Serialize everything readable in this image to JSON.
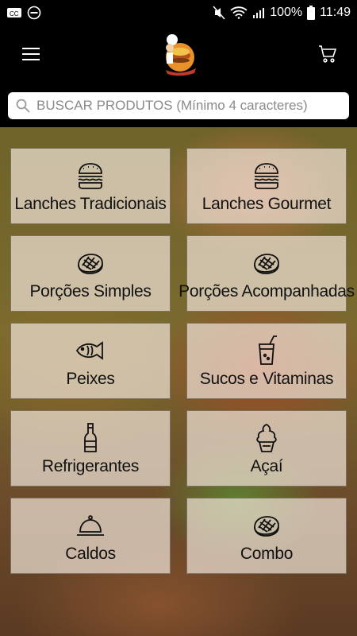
{
  "status_bar": {
    "battery": "100%",
    "time": "11:49"
  },
  "app_bar": {
    "menu_icon": "hamburger-menu-icon",
    "logo": "burger-chef-logo",
    "cart_icon": "shopping-cart-icon"
  },
  "search": {
    "placeholder": "BUSCAR PRODUTOS (Mínimo 4 caracteres)",
    "value": ""
  },
  "categories": [
    {
      "label": "Lanches Tradicionais",
      "icon": "burger-icon"
    },
    {
      "label": "Lanches Gourmet",
      "icon": "burger-icon"
    },
    {
      "label": "Porções Simples",
      "icon": "steak-icon"
    },
    {
      "label": "Porções Acompanhadas",
      "icon": "steak-icon"
    },
    {
      "label": "Peixes",
      "icon": "fish-icon"
    },
    {
      "label": "Sucos e Vitaminas",
      "icon": "drink-glass-icon"
    },
    {
      "label": "Refrigerantes",
      "icon": "bottle-icon"
    },
    {
      "label": "Açaí",
      "icon": "ice-cream-icon"
    },
    {
      "label": "Caldos",
      "icon": "cloche-icon"
    },
    {
      "label": "Combo",
      "icon": "steak-icon"
    }
  ]
}
